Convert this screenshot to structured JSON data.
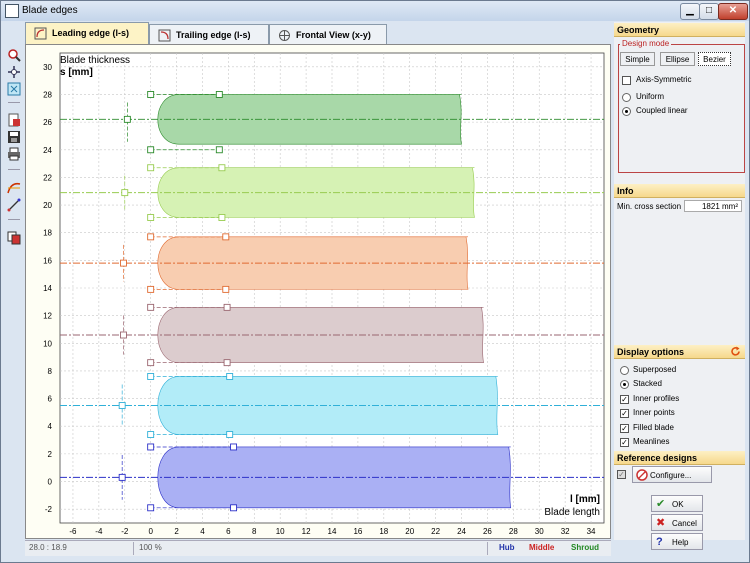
{
  "window": {
    "title": "Blade edges",
    "min": "0",
    "max": "1",
    "close": "r"
  },
  "tabs": [
    {
      "label": "Leading edge (l-s)",
      "active": true
    },
    {
      "label": "Trailing edge (l-s)",
      "active": false
    },
    {
      "label": "Frontal View (x-y)",
      "active": false
    }
  ],
  "toolbar_icons": [
    "zoom-icon",
    "pan-icon",
    "fit-icon",
    "export-icon",
    "save-icon",
    "print-icon",
    "curve-icon",
    "measure-icon",
    "copy-icon"
  ],
  "chart_data": {
    "type": "area",
    "title": "Blade thickness",
    "ylabel": "s [mm]",
    "xlabel": "l [mm]",
    "xlabel2": "Blade length",
    "xlim": [
      -7,
      35
    ],
    "ylim": [
      -3,
      31
    ],
    "xticks": [
      -6,
      -4,
      -2,
      0,
      2,
      4,
      6,
      8,
      10,
      12,
      14,
      16,
      18,
      20,
      22,
      24,
      26,
      28,
      30,
      32,
      34
    ],
    "yticks": [
      -2,
      0,
      2,
      4,
      6,
      8,
      10,
      12,
      14,
      16,
      18,
      20,
      22,
      24,
      26,
      28,
      30
    ],
    "grid": true,
    "series": [
      {
        "meanline_y": 26.2,
        "half_thickness": 1.8,
        "le_x": 0,
        "te_x": 24,
        "fill": "#a8d8a8",
        "line": "#2a8a2a",
        "handles": [
          [
            0,
            28
          ],
          [
            5.3,
            28
          ],
          [
            -1.8,
            26.2
          ],
          [
            0,
            24
          ],
          [
            5.3,
            24
          ]
        ]
      },
      {
        "meanline_y": 20.9,
        "half_thickness": 1.8,
        "le_x": 0,
        "te_x": 25,
        "fill": "#d6f2b4",
        "line": "#98cc50",
        "handles": [
          [
            0,
            22.7
          ],
          [
            5.5,
            22.7
          ],
          [
            -2,
            20.9
          ],
          [
            0,
            19.1
          ],
          [
            5.5,
            19.1
          ]
        ]
      },
      {
        "meanline_y": 15.8,
        "half_thickness": 1.9,
        "le_x": 0,
        "te_x": 24.5,
        "fill": "#f8cdb0",
        "line": "#e06a30",
        "handles": [
          [
            0,
            17.7
          ],
          [
            5.8,
            17.7
          ],
          [
            -2.1,
            15.8
          ],
          [
            0,
            13.9
          ],
          [
            5.8,
            13.9
          ]
        ]
      },
      {
        "meanline_y": 10.6,
        "half_thickness": 2.0,
        "le_x": 0,
        "te_x": 25.7,
        "fill": "#dcccce",
        "line": "#9a6670",
        "handles": [
          [
            0,
            12.6
          ],
          [
            5.9,
            12.6
          ],
          [
            -2.1,
            10.6
          ],
          [
            0,
            8.6
          ],
          [
            5.9,
            8.6
          ]
        ]
      },
      {
        "meanline_y": 5.5,
        "half_thickness": 2.1,
        "le_x": 0,
        "te_x": 26.8,
        "fill": "#b2ecf8",
        "line": "#30b0d8",
        "handles": [
          [
            0,
            7.6
          ],
          [
            6.1,
            7.6
          ],
          [
            -2.2,
            5.5
          ],
          [
            0,
            3.4
          ],
          [
            6.1,
            3.4
          ]
        ]
      },
      {
        "meanline_y": 0.3,
        "half_thickness": 2.2,
        "le_x": 0,
        "te_x": 27.8,
        "fill": "#aab0f4",
        "line": "#2c30c8",
        "handles": [
          [
            0,
            2.5
          ],
          [
            6.4,
            2.5
          ],
          [
            -2.2,
            0.3
          ],
          [
            0,
            -1.9
          ],
          [
            6.4,
            -1.9
          ]
        ]
      }
    ]
  },
  "status": {
    "coords": "28.0 : 18.9",
    "zoom": "100 %",
    "hub": "Hub",
    "middle": "Middle",
    "shroud": "Shroud",
    "hub_color": "#2233aa",
    "middle_color": "#cc2222",
    "shroud_color": "#228822"
  },
  "geometry": {
    "heading": "Geometry",
    "design_mode": "Design mode",
    "modes": [
      "Simple",
      "Ellipse",
      "Bezier"
    ],
    "axis_symmetric": "Axis-Symmetric",
    "uniform": "Uniform",
    "coupled_linear": "Coupled linear"
  },
  "info": {
    "heading": "Info",
    "label": "Min. cross section",
    "value": "1821 mm²"
  },
  "display": {
    "heading": "Display options",
    "superposed": "Superposed",
    "stacked": "Stacked",
    "inner_profiles": "Inner profiles",
    "inner_points": "Inner points",
    "filled_blade": "Filled blade",
    "meanlines": "Meanlines"
  },
  "reference": {
    "heading": "Reference designs",
    "configure": "Configure..."
  },
  "actions": {
    "ok": "OK",
    "cancel": "Cancel",
    "help": "Help"
  }
}
